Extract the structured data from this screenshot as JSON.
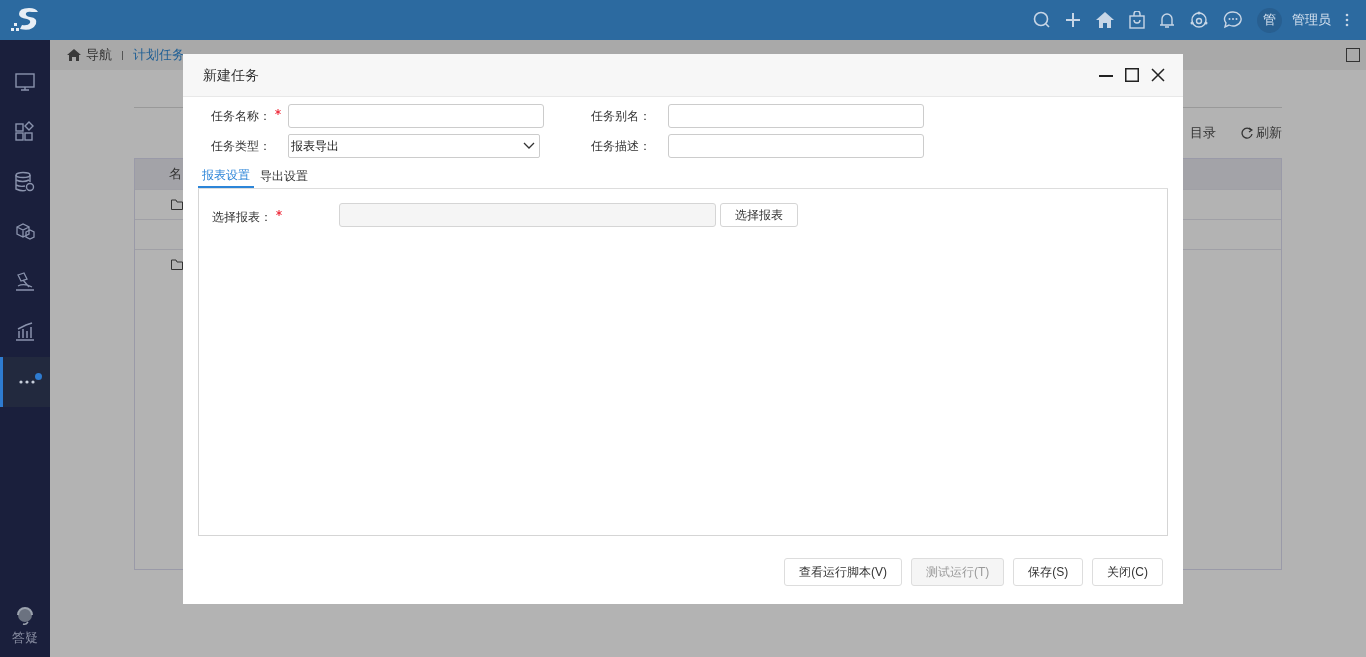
{
  "topbar": {
    "avatar": "管",
    "user": "管理员"
  },
  "sidebar": {
    "items": [
      {
        "kind": "monitor",
        "selected": false,
        "badge": false
      },
      {
        "kind": "apps",
        "selected": false,
        "badge": false
      },
      {
        "kind": "database",
        "selected": false,
        "badge": false
      },
      {
        "kind": "cubes",
        "selected": false,
        "badge": false
      },
      {
        "kind": "hammer",
        "selected": false,
        "badge": false
      },
      {
        "kind": "chart",
        "selected": false,
        "badge": false
      },
      {
        "kind": "more",
        "selected": true,
        "badge": true
      }
    ],
    "help": "答疑"
  },
  "breadcrumb": [
    "导航",
    "计划任务"
  ],
  "background": {
    "toolbar": [
      "目录",
      "刷新"
    ],
    "column": "名",
    "rows": [
      {
        "kind": "folder"
      },
      {
        "kind": "blank"
      },
      {
        "kind": "folder"
      }
    ]
  },
  "dialog": {
    "title": "新建任务",
    "fields": [
      {
        "label": "任务名称：",
        "required": true,
        "kind": "text"
      },
      {
        "label": "任务别名：",
        "required": false,
        "kind": "text"
      },
      {
        "label": "任务类型：",
        "required": false,
        "kind": "select",
        "value": "报表导出"
      },
      {
        "label": "任务描述：",
        "required": false,
        "kind": "text"
      }
    ],
    "tabs": [
      {
        "label": "报表设置",
        "selected": true
      },
      {
        "label": "导出设置",
        "selected": false
      }
    ],
    "report": {
      "label": "选择报表：",
      "required": true,
      "button": "选择报表"
    },
    "buttons": [
      {
        "label": "查看运行脚本(V)",
        "disabled": false
      },
      {
        "label": "测试运行(T)",
        "disabled": true
      },
      {
        "label": "保存(S)",
        "disabled": false
      },
      {
        "label": "关闭(C)",
        "disabled": false
      }
    ]
  }
}
